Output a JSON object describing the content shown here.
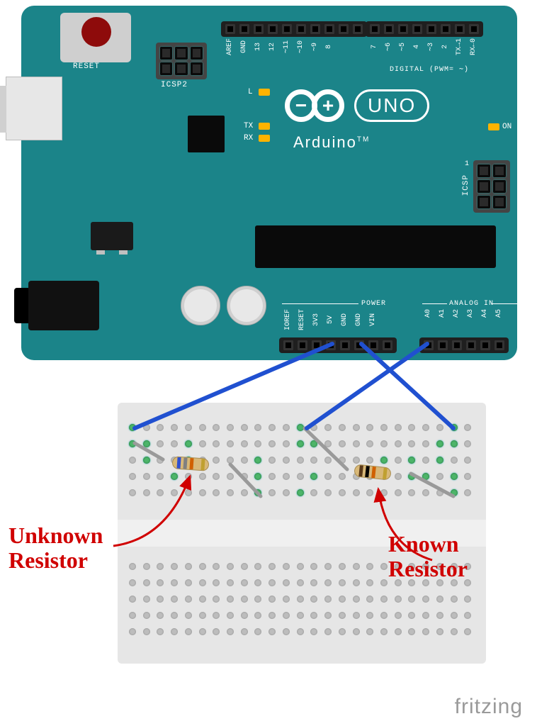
{
  "annotations": {
    "unknown_line1": "Unknown",
    "unknown_line2": "Resistor",
    "known_line1": "Known",
    "known_line2": "Resistor"
  },
  "arduino": {
    "reset": "RESET",
    "icsp2": "ICSP2",
    "L": "L",
    "TX": "TX",
    "RX": "RX",
    "ON": "ON",
    "name": "Arduino",
    "tm": "TM",
    "uno": "UNO",
    "minus": "−",
    "plus": "+",
    "digital": "DIGITAL (PWM= ∼)",
    "icsp": "ICSP",
    "icsp_1": "1",
    "power": "POWER",
    "analog_in": "ANALOG IN",
    "pins_top_a": [
      "AREF",
      "GND",
      "13",
      "12",
      "∼11",
      "∼10",
      "∼9",
      "8"
    ],
    "pins_top_b": [
      "7",
      "∼6",
      "∼5",
      "4",
      "∼3",
      "2",
      "TX→1",
      "RX←0"
    ],
    "pins_power": [
      "IOREF",
      "RESET",
      "3V3",
      "5V",
      "GND",
      "GND",
      "VIN"
    ],
    "pins_analog": [
      "A0",
      "A1",
      "A2",
      "A3",
      "A4",
      "A5"
    ]
  },
  "watermark": "fritzing",
  "components": {
    "unknown_resistor": {
      "role": "Unknown resistor under test",
      "bands": [
        "blue",
        "grey",
        "orange",
        "gold"
      ]
    },
    "known_resistor": {
      "role": "Reference resistor of known value",
      "bands": [
        "brown",
        "black",
        "orange",
        "gold"
      ]
    }
  },
  "wires": [
    {
      "color": "blue",
      "from": "Arduino 5V",
      "to": "breadboard left node (unknown resistor left lead)"
    },
    {
      "color": "blue",
      "from": "Arduino GND",
      "to": "breadboard right node (known resistor right lead)"
    },
    {
      "color": "blue",
      "from": "Arduino A0",
      "to": "breadboard mid node (junction between resistors)"
    }
  ]
}
